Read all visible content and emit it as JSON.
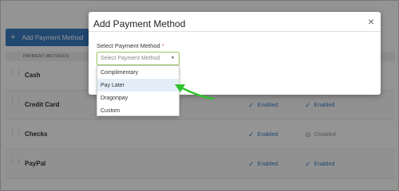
{
  "page": {
    "add_button_label": "Add Payment Method",
    "table": {
      "header": "PAYMENT METHODS",
      "rows": [
        {
          "method": "Cash"
        },
        {
          "method": "Credit Card"
        },
        {
          "method": "Checks",
          "status1": "Enabled",
          "status2": "Disabled"
        },
        {
          "method": "PayPal",
          "status1": "Enabled",
          "status2": "Enabled"
        }
      ],
      "row2_status1": "Enabled",
      "row2_status2": "Enabled"
    }
  },
  "modal": {
    "title": "Add Payment Method",
    "close_icon": "×",
    "field_label": "Select Payment Method",
    "required_mark": "*",
    "select_placeholder": "Select Payment Method",
    "options": [
      "Complimentary",
      "Pay Later",
      "Dragonpay",
      "Custom"
    ],
    "highlighted_option": "Pay Later"
  },
  "annotation": {
    "arrow_color": "#2ec42e"
  },
  "colors": {
    "accent": "#3a7cc2",
    "overlay": "rgba(0,0,0,0.42)"
  }
}
